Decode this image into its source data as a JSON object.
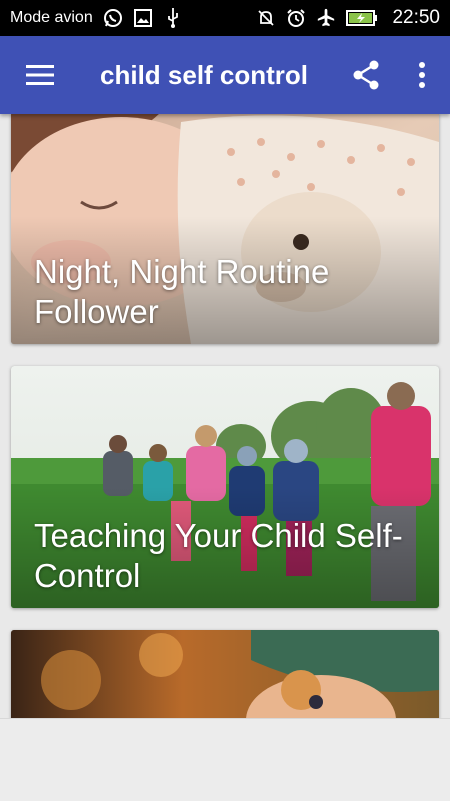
{
  "status_bar": {
    "carrier": "Mode avion",
    "time": "22:50",
    "icons": [
      "whatsapp-icon",
      "image-icon",
      "usb-icon",
      "mute-icon",
      "alarm-icon",
      "airplane-icon",
      "battery-charging-icon"
    ]
  },
  "app_bar": {
    "title": "child self control",
    "icons": [
      "hamburger-menu-icon",
      "share-icon",
      "more-vert-icon"
    ]
  },
  "cards": [
    {
      "title": "Night, Night Routine Follower",
      "image": "sleeping-child-with-teddy-bear"
    },
    {
      "title": "Teaching Your Child Self-Control",
      "image": "children-playing-on-field"
    },
    {
      "title": "",
      "image": "clown-doll"
    }
  ],
  "colors": {
    "primary": "#3f51b5",
    "status_bar": "#000000",
    "background": "#e9e9e9"
  }
}
